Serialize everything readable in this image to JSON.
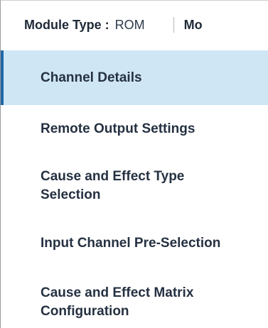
{
  "header": {
    "module_type_label": "Module Type :",
    "module_type_value": "ROM",
    "next_label": "Mo"
  },
  "nav": {
    "items": [
      {
        "label": "Channel Details"
      },
      {
        "label": "Remote Output Settings"
      },
      {
        "label": "Cause and Effect Type Selection"
      },
      {
        "label": "Input Channel Pre-Selection"
      },
      {
        "label": "Cause and Effect Matrix Configuration"
      }
    ],
    "active_index": 0
  },
  "colors": {
    "active_background": "#cfe6f5",
    "active_indicator": "#1f67a8"
  }
}
